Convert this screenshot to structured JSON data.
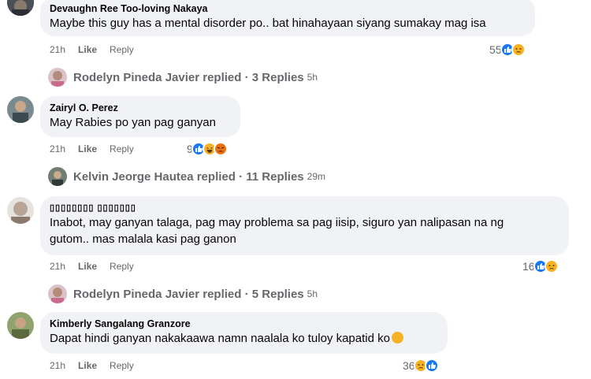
{
  "comments": [
    {
      "author": "Devaughn Ree Too-loving Nakaya",
      "text": "Maybe this guy has a mental disorder po.. bat hinahayaan siyang sumakay mag isa",
      "time": "21h",
      "like": "Like",
      "reply": "Reply",
      "reaction_count": "55",
      "reactions": [
        "like",
        "sad"
      ],
      "replies": {
        "name": "Rodelyn Pineda Javier replied",
        "sep": " · ",
        "count": "3 Replies",
        "time": "5h"
      }
    },
    {
      "author": "Zairyl O. Perez",
      "text": "May Rabies po yan pag ganyan",
      "time": "21h",
      "like": "Like",
      "reply": "Reply",
      "reaction_count": "9",
      "reactions": [
        "like",
        "haha",
        "angry"
      ],
      "replies": {
        "name": "Kelvin Jeorge Hautea replied",
        "sep": " · ",
        "count": "11 Replies",
        "time": "29m"
      }
    },
    {
      "author": "𝙳𝚎𝚟𝚊𝚞𝚐𝚑𝚗 𝙽𝚊𝚔𝚊𝚢𝚊",
      "author_display": "▯▯▯▯▯▯▯▯ ▯▯▯▯▯▯▯",
      "text_line1": "Inabot, may ganyan talaga, pag may problema sa pag iisip, siguro yan nalipasan na ng",
      "text_line2": "gutom.. mas malala kasi pag ganon",
      "time": "21h",
      "like": "Like",
      "reply": "Reply",
      "reaction_count": "16",
      "reactions": [
        "like",
        "sad"
      ],
      "replies": {
        "name": "Rodelyn Pineda Javier replied",
        "sep": " · ",
        "count": "5 Replies",
        "time": "5h"
      }
    },
    {
      "author": "Kimberly Sangalang Granzore",
      "text": "Dapat hindi ganyan nakakaawa namn naalala ko tuloy kapatid ko",
      "time": "21h",
      "like": "Like",
      "reply": "Reply",
      "reaction_count": "36",
      "reactions": [
        "sad",
        "like"
      ]
    }
  ],
  "colors": {
    "bubble": "#f0f2f5",
    "meta": "#65676b",
    "like_blue": "#1877f2",
    "sad_yellow": "#f7b125",
    "angry": "#e9710f"
  }
}
